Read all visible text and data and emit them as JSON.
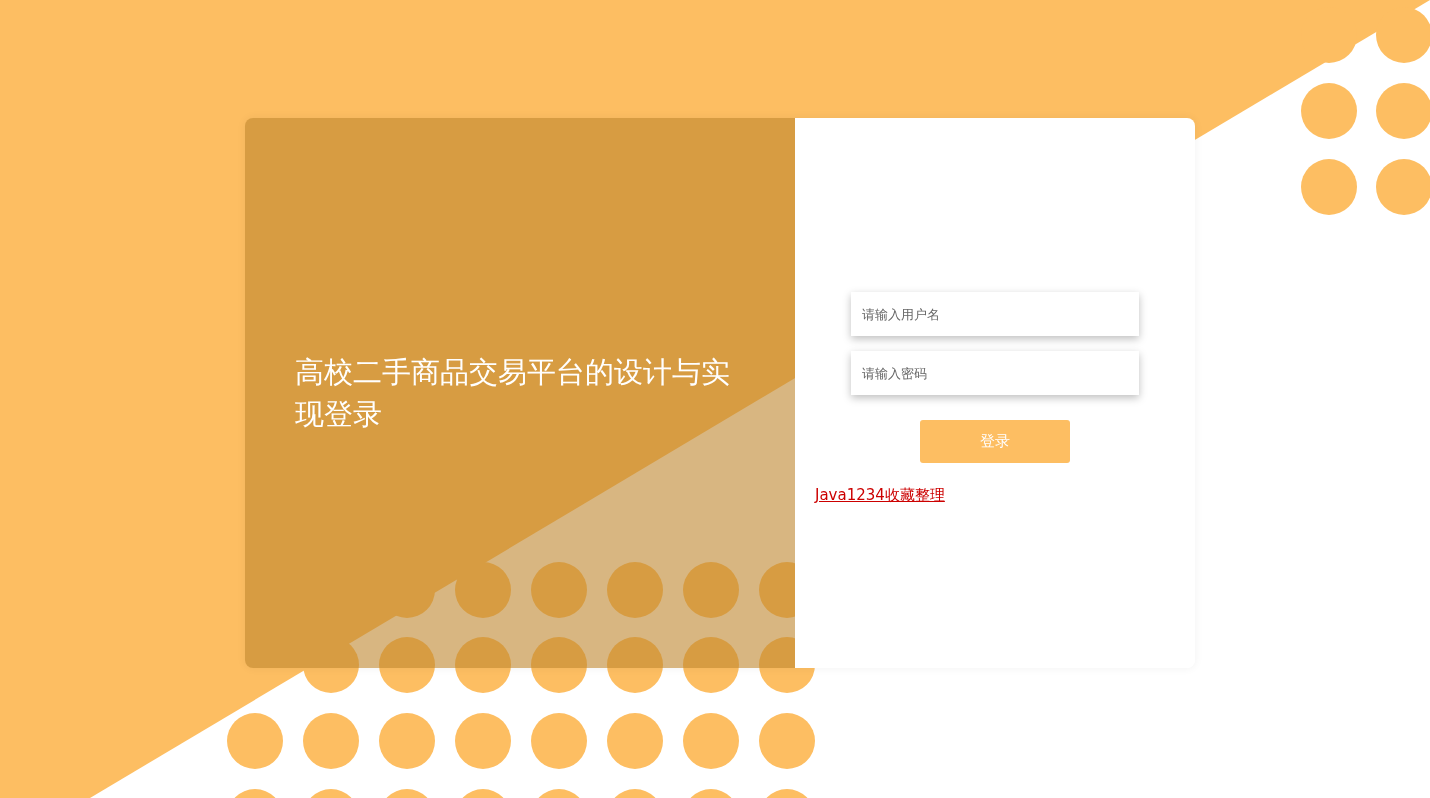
{
  "title": "高校二手商品交易平台的设计与实现登录",
  "username_field": {
    "placeholder": "请输入用户名"
  },
  "password_field": {
    "placeholder": "请输入密码"
  },
  "login_button": {
    "label": "登录"
  },
  "link": {
    "text": "Java1234收藏整理"
  }
}
